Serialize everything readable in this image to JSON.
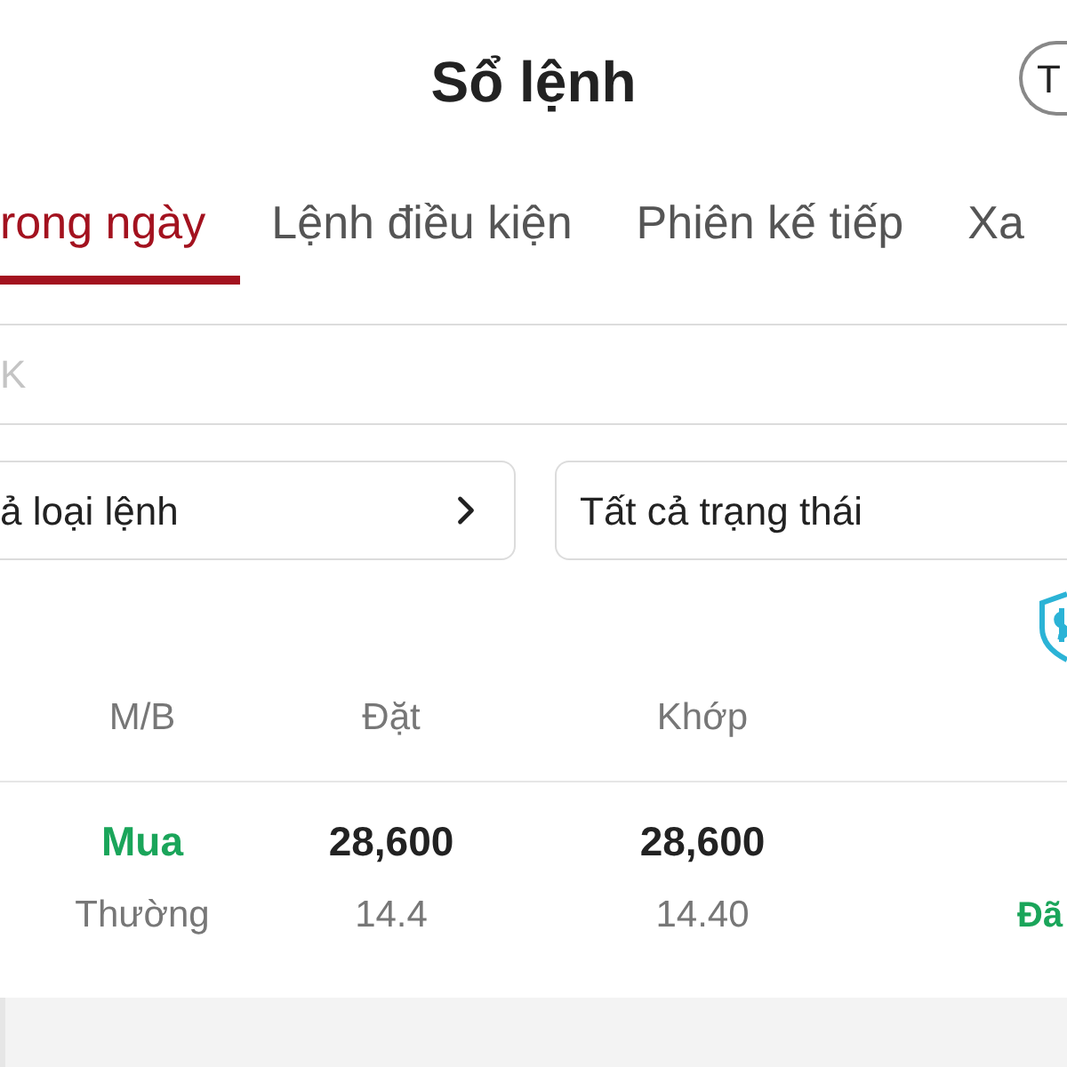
{
  "header": {
    "title": "Sổ lệnh",
    "action_button": "T"
  },
  "tabs": [
    {
      "label": "rong ngày",
      "selected": true
    },
    {
      "label": "Lệnh điều kiện",
      "selected": false
    },
    {
      "label": "Phiên kế tiếp",
      "selected": false
    },
    {
      "label": "Xa",
      "selected": false
    }
  ],
  "search": {
    "placeholder": "K"
  },
  "filters": [
    {
      "label": "ả loại lệnh",
      "has_chevron": true
    },
    {
      "label": "Tất cả trạng thái",
      "has_chevron": false
    }
  ],
  "table": {
    "columns": [
      "M/B",
      "Đặt",
      "Khớp"
    ],
    "rows": [
      {
        "side": "Mua",
        "order_price": "28,600",
        "match_price": "28,600",
        "order_type": "Thường",
        "order_volume": "14.4",
        "match_volume": "14.40",
        "status": "Đã"
      }
    ]
  }
}
